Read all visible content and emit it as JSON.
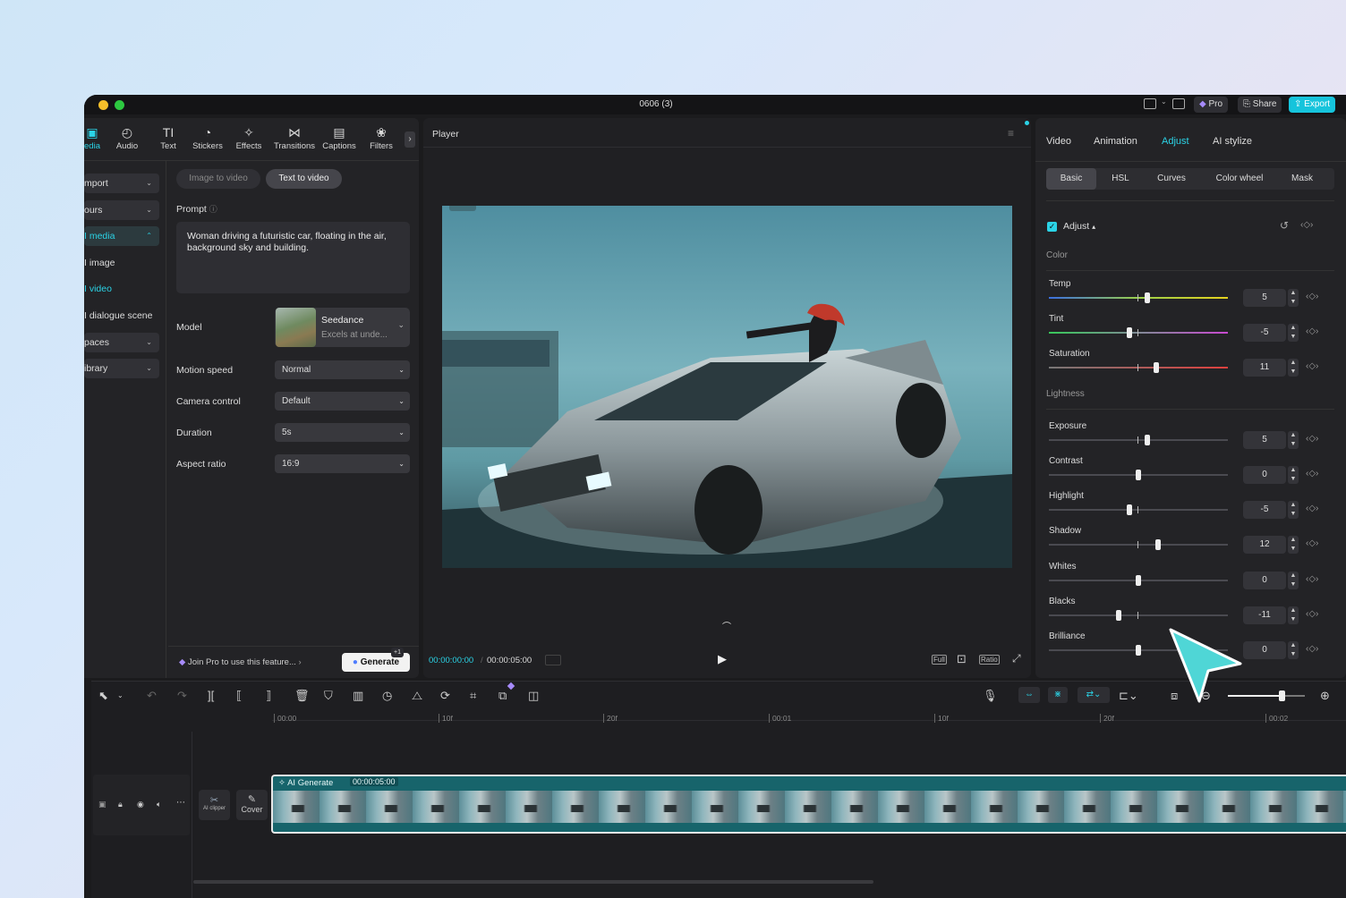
{
  "window": {
    "title": "0606 (3)"
  },
  "titlebar": {
    "pro": "Pro",
    "share": "Share",
    "export": "Export"
  },
  "toolbar": {
    "items": [
      {
        "label": "edia",
        "icon": "media-icon"
      },
      {
        "label": "Audio",
        "icon": "audio-icon"
      },
      {
        "label": "Text",
        "icon": "text-icon"
      },
      {
        "label": "Stickers",
        "icon": "stickers-icon"
      },
      {
        "label": "Effects",
        "icon": "effects-icon"
      },
      {
        "label": "Transitions",
        "icon": "transitions-icon"
      },
      {
        "label": "Captions",
        "icon": "captions-icon"
      },
      {
        "label": "Filters",
        "icon": "filters-icon"
      }
    ]
  },
  "sidebar": {
    "items": [
      "mport",
      "ours",
      "I media",
      "I image",
      "I video",
      "I dialogue scene",
      "paces",
      "ibrary"
    ]
  },
  "aigen": {
    "tab_image": "Image to video",
    "tab_text": "Text to video",
    "prompt_label": "Prompt",
    "prompt_text": "Woman driving a futuristic car, floating in the air, background sky and building.",
    "model_label": "Model",
    "model_name": "Seedance",
    "model_desc": "Excels at unde...",
    "motion_label": "Motion speed",
    "motion_value": "Normal",
    "camera_label": "Camera control",
    "camera_value": "Default",
    "duration_label": "Duration",
    "duration_value": "5s",
    "aspect_label": "Aspect ratio",
    "aspect_value": "16:9",
    "join_pro": "Join Pro to use this feature...",
    "generate": "Generate",
    "gen_badge": "+1"
  },
  "player": {
    "title": "Player",
    "current_time": "00:00:00:00",
    "total_time": "00:00:05:00",
    "full": "Full",
    "ratio": "Ratio"
  },
  "inspector": {
    "tabs": [
      "Video",
      "Animation",
      "Adjust",
      "AI stylize"
    ],
    "subtabs": [
      "Basic",
      "HSL",
      "Curves",
      "Color wheel",
      "Mask"
    ],
    "adjust_label": "Adjust",
    "color_section": "Color",
    "lightness_section": "Lightness",
    "sliders": [
      {
        "name": "Temp",
        "value": "5",
        "level": 0.55
      },
      {
        "name": "Tint",
        "value": "-5",
        "level": 0.45
      },
      {
        "name": "Saturation",
        "value": "11",
        "level": 0.6
      },
      {
        "name": "Exposure",
        "value": "5",
        "level": 0.55
      },
      {
        "name": "Contrast",
        "value": "0",
        "level": 0.5
      },
      {
        "name": "Highlight",
        "value": "-5",
        "level": 0.45
      },
      {
        "name": "Shadow",
        "value": "12",
        "level": 0.61
      },
      {
        "name": "Whites",
        "value": "0",
        "level": 0.5
      },
      {
        "name": "Blacks",
        "value": "-11",
        "level": 0.39
      },
      {
        "name": "Brilliance",
        "value": "0",
        "level": 0.5
      }
    ]
  },
  "timeline": {
    "ruler": [
      "00:00",
      "10f",
      "20f",
      "00:01",
      "10f",
      "20f",
      "00:02"
    ],
    "clip_label": "AI Generate",
    "clip_duration": "00:00:05:00",
    "ai_clipper": "AI clipper",
    "cover": "Cover",
    "zoom_level": 0.7
  },
  "colors": {
    "accent": "#2bd3e6",
    "bg": "#1b1b1d",
    "panel": "#252528"
  }
}
